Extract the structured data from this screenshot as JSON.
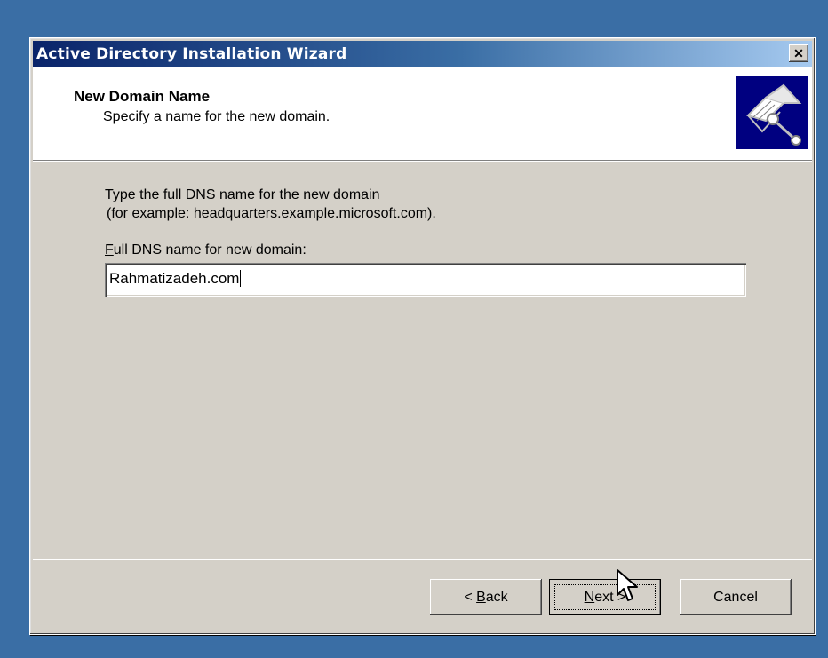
{
  "window": {
    "title": "Active Directory Installation Wizard",
    "close_glyph": "✕"
  },
  "header": {
    "title": "New Domain Name",
    "subtitle": "Specify a name for the new domain.",
    "icon": "book-wrench-icon"
  },
  "main": {
    "instruction_line1": "Type the full DNS name for the new domain",
    "instruction_line2": "(for example: headquarters.example.microsoft.com).",
    "field_label_accel": "F",
    "field_label_rest": "ull DNS name for new domain:",
    "dns_value": "Rahmatizadeh.com"
  },
  "buttons": {
    "back_prefix": "< ",
    "back_accel": "B",
    "back_rest": "ack",
    "next_accel": "N",
    "next_rest": "ext >",
    "cancel": "Cancel"
  },
  "colors": {
    "desktop": "#3a6ea5",
    "titlebar_start": "#0a246a",
    "face": "#d4d0c8"
  }
}
